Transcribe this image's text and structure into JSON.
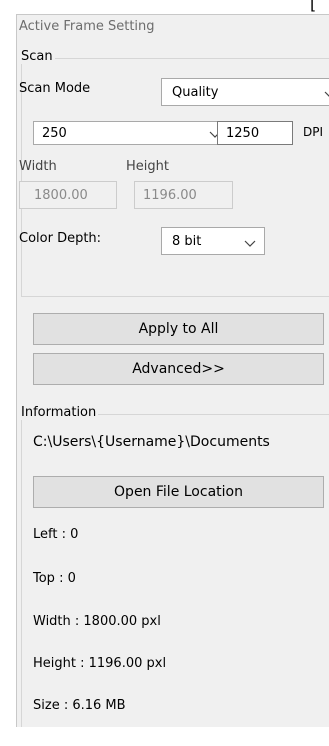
{
  "panel": {
    "title": "Active Frame Setting"
  },
  "scan": {
    "legend": "Scan",
    "scan_mode_label": "Scan Mode",
    "scan_mode_value": "Quality",
    "resolution_value": "250",
    "dpi_value": "1250",
    "dpi_unit": "DPI",
    "width_label": "Width",
    "height_label": "Height",
    "width_value": "1800.00",
    "height_value": "1196.00",
    "color_depth_label": "Color Depth:",
    "color_depth_value": "8 bit"
  },
  "actions": {
    "apply_to_all": "Apply to All",
    "advanced": "Advanced>>"
  },
  "information": {
    "legend": "Information",
    "path": "C:\\Users\\{Username}\\Documents",
    "open_location": "Open File Location",
    "left": "Left : 0",
    "top": "Top : 0",
    "width": "Width : 1800.00 pxl",
    "height": "Height : 1196.00 pxl",
    "size": "Size : 6.16 MB"
  },
  "icons": {
    "top_partial": "["
  }
}
